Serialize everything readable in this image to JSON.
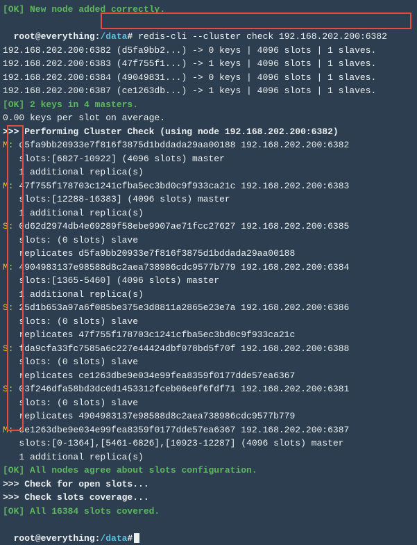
{
  "top_ok": "[OK] New node added correctly.",
  "prompt": {
    "user": "root@everything",
    "sep": ":",
    "path": "/data",
    "end": "#"
  },
  "command": "redis-cli --cluster check 192.168.202.200:6382",
  "slots_summary": [
    "192.168.202.200:6382 (d5fa9bb2...) -> 0 keys | 4096 slots | 1 slaves.",
    "192.168.202.200:6383 (47f755f1...) -> 1 keys | 4096 slots | 1 slaves.",
    "192.168.202.200:6384 (49049831...) -> 0 keys | 4096 slots | 1 slaves.",
    "192.168.202.200:6387 (ce1263db...) -> 1 keys | 4096 slots | 1 slaves."
  ],
  "ok_keys": "[OK] 2 keys in 4 masters.",
  "avg_keys": "0.00 keys per slot on average.",
  "perform_check": ">>> Performing Cluster Check (using node 192.168.202.200:6382)",
  "nodes": [
    {
      "role": "M:",
      "id": "d5fa9bb20933e7f816f3875d1bddada29aa00188 192.168.202.200:6382",
      "slots": "   slots:[6827-10922] (4096 slots) master",
      "extra": "   1 additional replica(s)"
    },
    {
      "role": "M:",
      "id": "47f755f178703c1241cfba5ec3bd0c9f933ca21c 192.168.202.200:6383",
      "slots": "   slots:[12288-16383] (4096 slots) master",
      "extra": "   1 additional replica(s)"
    },
    {
      "role": "S:",
      "id": "0d62d2974db4e69289f58ebe9907ae71fcc27627 192.168.202.200:6385",
      "slots": "   slots: (0 slots) slave",
      "extra": "   replicates d5fa9bb20933e7f816f3875d1bddada29aa00188"
    },
    {
      "role": "M:",
      "id": "4904983137e98588d8c2aea738986cdc9577b779 192.168.202.200:6384",
      "slots": "   slots:[1365-5460] (4096 slots) master",
      "extra": "   1 additional replica(s)"
    },
    {
      "role": "S:",
      "id": "25d1b653a97a6f085be375e3d8811a2865e23e7a 192.168.202.200:6386",
      "slots": "   slots: (0 slots) slave",
      "extra": "   replicates 47f755f178703c1241cfba5ec3bd0c9f933ca21c"
    },
    {
      "role": "S:",
      "id": "fda9cfa33fc7585a6c227e44424dbf078bd5f70f 192.168.202.200:6388",
      "slots": "   slots: (0 slots) slave",
      "extra": "   replicates ce1263dbe9e034e99fea8359f0177dde57ea6367"
    },
    {
      "role": "S:",
      "id": "03f246dfa58bd3dc0d1453312fceb06e0f6fdf71 192.168.202.200:6381",
      "slots": "   slots: (0 slots) slave",
      "extra": "   replicates 4904983137e98588d8c2aea738986cdc9577b779"
    },
    {
      "role": "M:",
      "id": "ce1263dbe9e034e99fea8359f0177dde57ea6367 192.168.202.200:6387",
      "slots": "   slots:[0-1364],[5461-6826],[10923-12287] (4096 slots) master",
      "extra": "   1 additional replica(s)"
    }
  ],
  "ok_nodes_agree": "[OK] All nodes agree about slots configuration.",
  "check_open": ">>> Check for open slots...",
  "check_coverage": ">>> Check slots coverage...",
  "ok_covered": "[OK] All 16384 slots covered."
}
